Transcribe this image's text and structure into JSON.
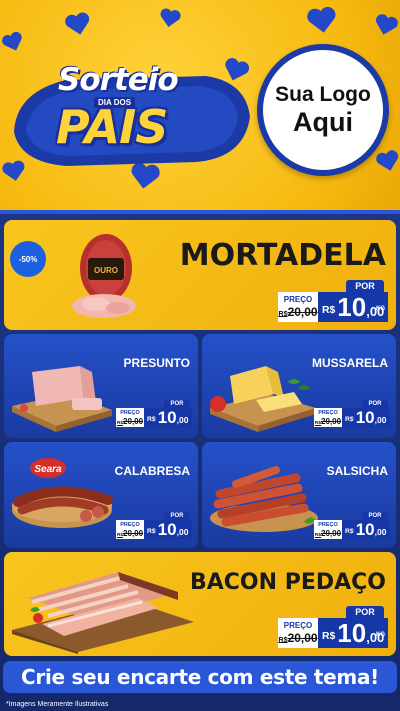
{
  "header": {
    "title_line1": "Sorteio",
    "title_tag": "DIA DOS",
    "title_line2": "PAIS",
    "logo_line1": "Sua Logo",
    "logo_line2": "Aqui"
  },
  "colors": {
    "brand_blue": "#1c3aa6",
    "accent_yellow": "#f7c21a",
    "price_blue": "#1537a8"
  },
  "discount_badge": "-50%",
  "products": [
    {
      "name": "MORTADELA",
      "por": "POR",
      "preco_label": "PREÇO",
      "old_price": "R$ 20,00",
      "old_cur": "R$",
      "old_val": "20,00",
      "currency": "R$",
      "price_int": "10",
      "price_cents": ",00",
      "unit": "KG"
    },
    {
      "name": "PRESUNTO",
      "por": "POR",
      "preco_label": "PREÇO",
      "old_cur": "R$",
      "old_val": "20,00",
      "currency": "R$",
      "price_int": "10",
      "price_cents": ",00"
    },
    {
      "name": "MUSSARELA",
      "por": "POR",
      "preco_label": "PREÇO",
      "old_cur": "R$",
      "old_val": "20,00",
      "currency": "R$",
      "price_int": "10",
      "price_cents": ",00"
    },
    {
      "name": "CALABRESA",
      "por": "POR",
      "preco_label": "PREÇO",
      "old_cur": "R$",
      "old_val": "20,00",
      "currency": "R$",
      "price_int": "10",
      "price_cents": ",00"
    },
    {
      "name": "SALSICHA",
      "por": "POR",
      "preco_label": "PREÇO",
      "old_cur": "R$",
      "old_val": "20,00",
      "currency": "R$",
      "price_int": "10",
      "price_cents": ",00"
    },
    {
      "name": "BACON PEDAÇO",
      "por": "POR",
      "preco_label": "PREÇO",
      "old_cur": "R$",
      "old_val": "20,00",
      "currency": "R$",
      "price_int": "10",
      "price_cents": ",00",
      "unit": "KG"
    }
  ],
  "mortadela_brand": "OURO",
  "calabresa_brand": "Seara",
  "cta": "Crie seu encarte com este tema!",
  "footnote": "*Imagens Meramente Ilustrativas"
}
